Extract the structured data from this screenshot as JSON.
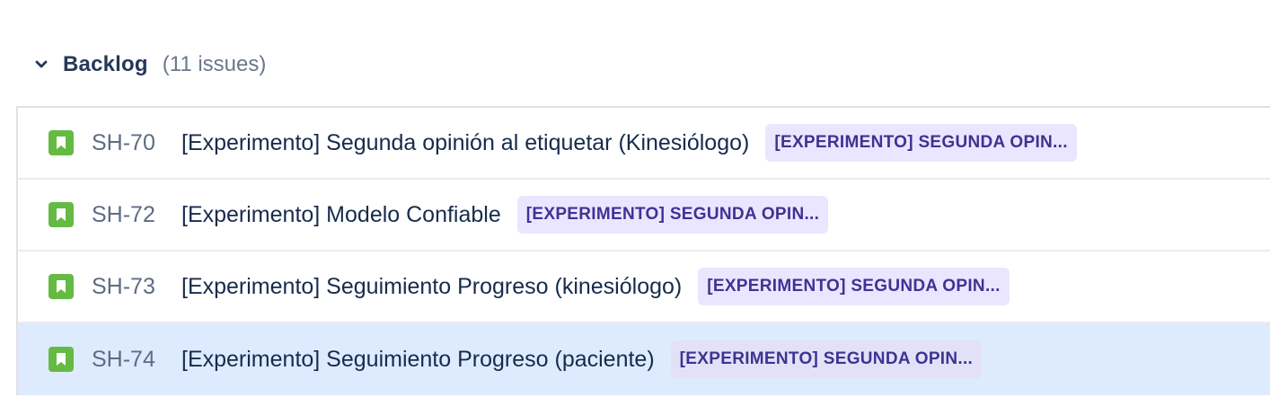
{
  "backlog": {
    "title": "Backlog",
    "count": "(11 issues)"
  },
  "colors": {
    "story_icon": "#65ba43",
    "epic_bg": "#eae6ff",
    "epic_text": "#403294",
    "selected_row": "#deebff"
  },
  "issues": [
    {
      "icon": "story-icon",
      "key": "SH-70",
      "summary": "[Experimento] Segunda opinión al etiquetar (Kinesiólogo)",
      "epic": "[EXPERIMENTO] SEGUNDA OPIN...",
      "selected": false
    },
    {
      "icon": "story-icon",
      "key": "SH-72",
      "summary": "[Experimento] Modelo Confiable",
      "epic": "[EXPERIMENTO] SEGUNDA OPIN...",
      "selected": false
    },
    {
      "icon": "story-icon",
      "key": "SH-73",
      "summary": "[Experimento] Seguimiento Progreso (kinesiólogo)",
      "epic": "[EXPERIMENTO] SEGUNDA OPIN...",
      "selected": false
    },
    {
      "icon": "story-icon",
      "key": "SH-74",
      "summary": "[Experimento] Seguimiento Progreso (paciente)",
      "epic": "[EXPERIMENTO] SEGUNDA OPIN...",
      "selected": true
    }
  ]
}
